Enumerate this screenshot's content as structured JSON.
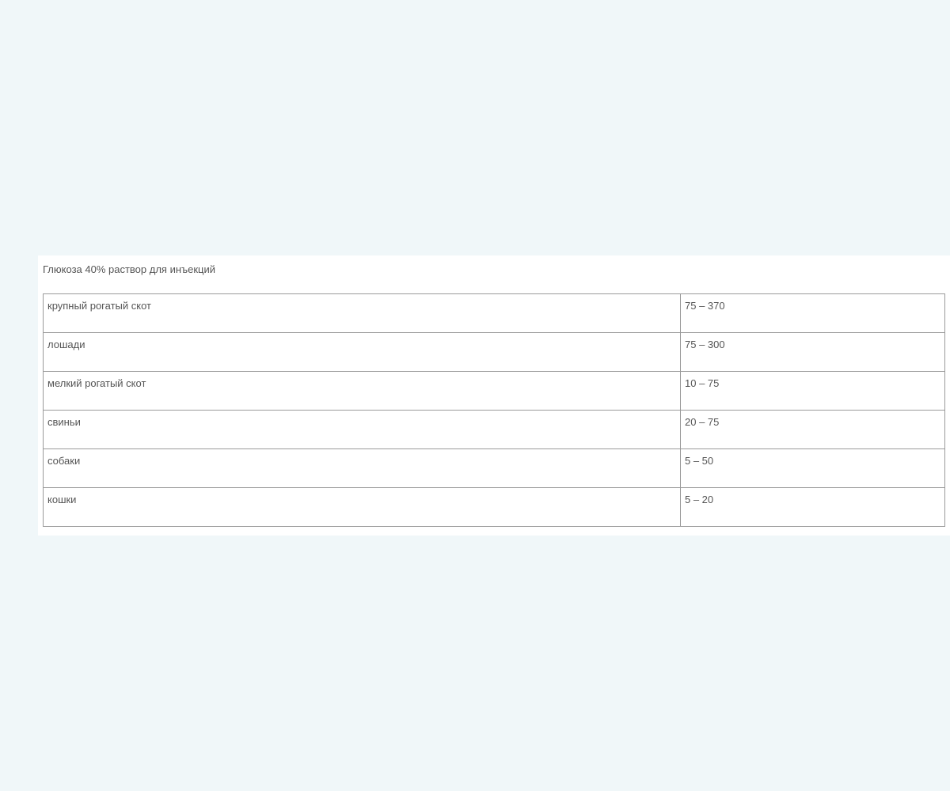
{
  "caption": "Глюкоза 40% раствор для инъекций",
  "rows": [
    {
      "animal": "крупный рогатый скот",
      "dose": "75 – 370"
    },
    {
      "animal": "лошади",
      "dose": "75 – 300"
    },
    {
      "animal": "мелкий рогатый скот",
      "dose": "10 – 75"
    },
    {
      "animal": "свиньи",
      "dose": "20 – 75"
    },
    {
      "animal": "собаки",
      "dose": "5 – 50"
    },
    {
      "animal": "кошки",
      "dose": "5 – 20"
    }
  ]
}
